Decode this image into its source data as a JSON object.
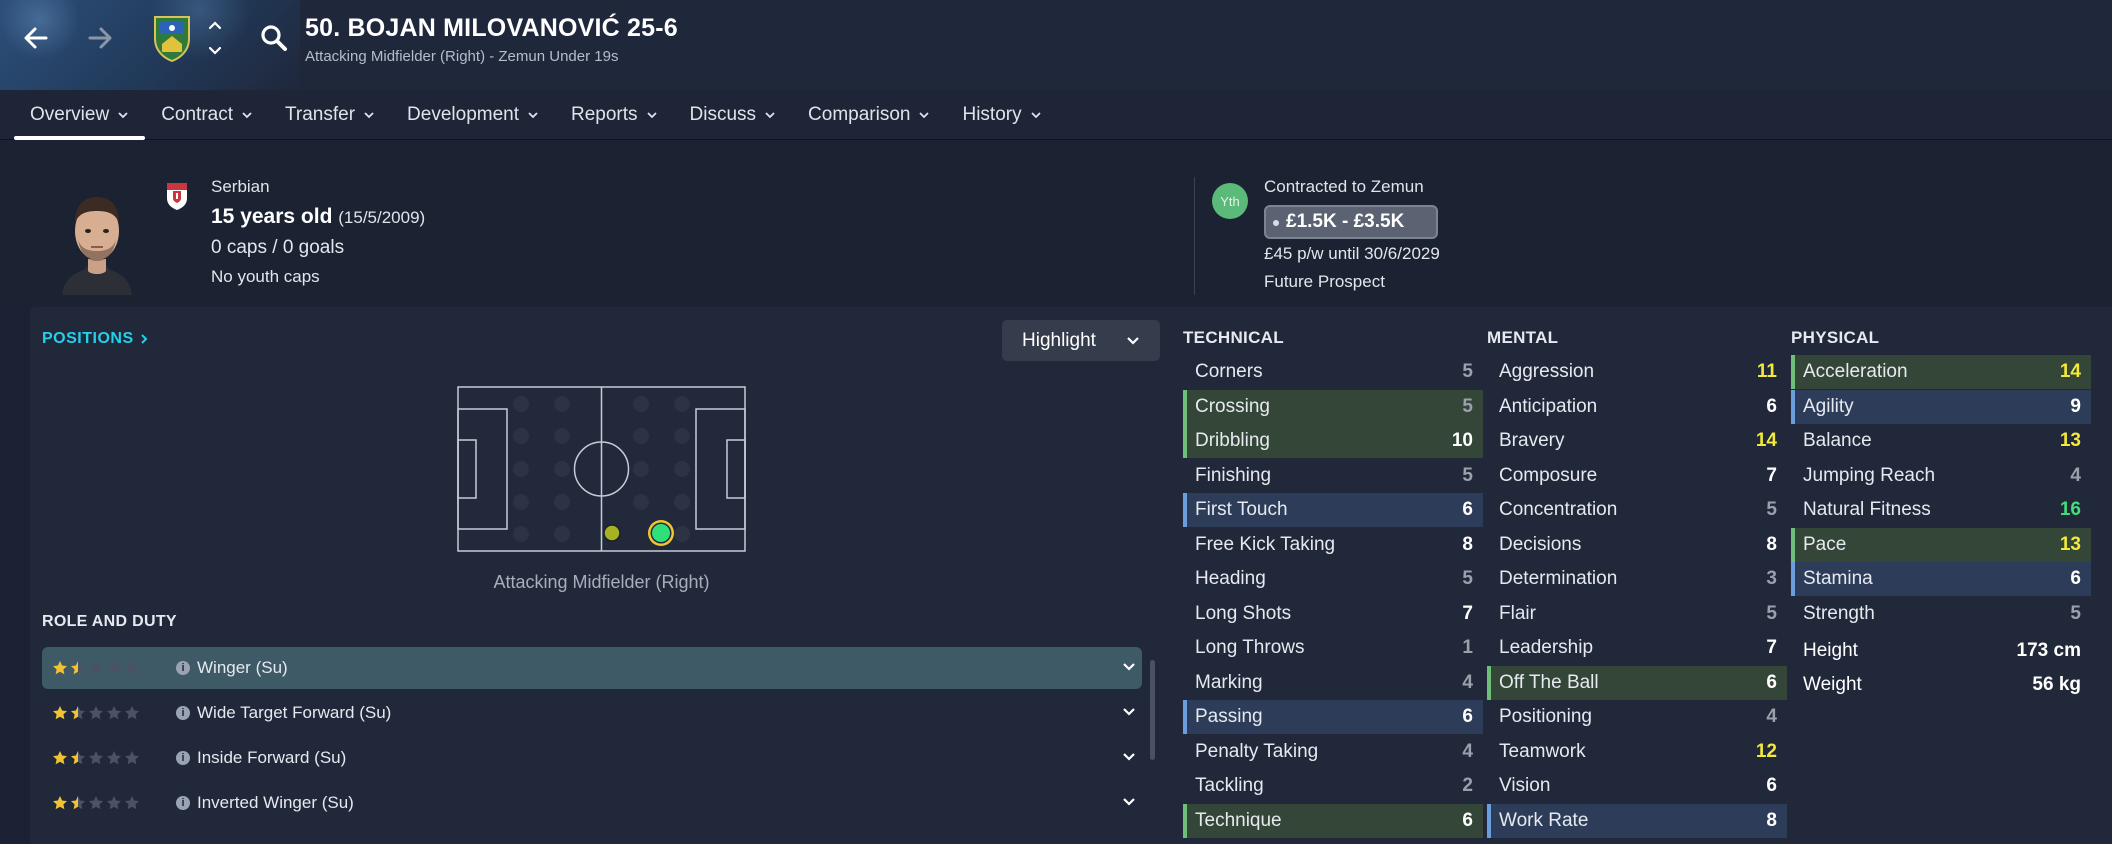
{
  "header": {
    "title": "50. BOJAN MILOVANOVIĆ 25-6",
    "subtitle": "Attacking Midfielder (Right) - Zemun Under 19s"
  },
  "tabs": [
    {
      "label": "Overview"
    },
    {
      "label": "Contract"
    },
    {
      "label": "Transfer"
    },
    {
      "label": "Development"
    },
    {
      "label": "Reports"
    },
    {
      "label": "Discuss"
    },
    {
      "label": "Comparison"
    },
    {
      "label": "History"
    }
  ],
  "profile": {
    "nationality": "Serbian",
    "age": "15 years old",
    "dob": "(15/5/2009)",
    "caps": "0 caps / 0 goals",
    "youth_caps": "No youth caps",
    "badge": "Yth",
    "contract": "Contracted to Zemun",
    "value": "£1.5K - £3.5K",
    "wage": "£45 p/w until 30/6/2029",
    "prospect": "Future Prospect"
  },
  "positions": {
    "link": "POSITIONS",
    "highlight": "Highlight",
    "caption": "Attacking Midfielder (Right)"
  },
  "role_duty": {
    "title": "ROLE AND DUTY",
    "roles": [
      {
        "label": "Winger (Su)",
        "stars": 1.5
      },
      {
        "label": "Wide Target Forward (Su)",
        "stars": 1.5
      },
      {
        "label": "Inside Forward (Su)",
        "stars": 1.5
      },
      {
        "label": "Inverted Winger (Su)",
        "stars": 1.5
      }
    ]
  },
  "attributes": {
    "technical_title": "TECHNICAL",
    "mental_title": "MENTAL",
    "physical_title": "PHYSICAL",
    "technical": [
      {
        "name": "Corners",
        "value": "5",
        "hl": "plain"
      },
      {
        "name": "Crossing",
        "value": "5",
        "hl": "green"
      },
      {
        "name": "Dribbling",
        "value": "10",
        "hl": "green"
      },
      {
        "name": "Finishing",
        "value": "5",
        "hl": "plain"
      },
      {
        "name": "First Touch",
        "value": "6",
        "hl": "blue"
      },
      {
        "name": "Free Kick Taking",
        "value": "8",
        "hl": "plain"
      },
      {
        "name": "Heading",
        "value": "5",
        "hl": "plain"
      },
      {
        "name": "Long Shots",
        "value": "7",
        "hl": "plain"
      },
      {
        "name": "Long Throws",
        "value": "1",
        "hl": "plain"
      },
      {
        "name": "Marking",
        "value": "4",
        "hl": "plain"
      },
      {
        "name": "Passing",
        "value": "6",
        "hl": "blue"
      },
      {
        "name": "Penalty Taking",
        "value": "4",
        "hl": "plain"
      },
      {
        "name": "Tackling",
        "value": "2",
        "hl": "plain"
      },
      {
        "name": "Technique",
        "value": "6",
        "hl": "green"
      }
    ],
    "mental": [
      {
        "name": "Aggression",
        "value": "11",
        "hl": "plain"
      },
      {
        "name": "Anticipation",
        "value": "6",
        "hl": "plain"
      },
      {
        "name": "Bravery",
        "value": "14",
        "hl": "plain"
      },
      {
        "name": "Composure",
        "value": "7",
        "hl": "plain"
      },
      {
        "name": "Concentration",
        "value": "5",
        "hl": "plain"
      },
      {
        "name": "Decisions",
        "value": "8",
        "hl": "plain"
      },
      {
        "name": "Determination",
        "value": "3",
        "hl": "plain"
      },
      {
        "name": "Flair",
        "value": "5",
        "hl": "plain"
      },
      {
        "name": "Leadership",
        "value": "7",
        "hl": "plain"
      },
      {
        "name": "Off The Ball",
        "value": "6",
        "hl": "green"
      },
      {
        "name": "Positioning",
        "value": "4",
        "hl": "plain"
      },
      {
        "name": "Teamwork",
        "value": "12",
        "hl": "plain"
      },
      {
        "name": "Vision",
        "value": "6",
        "hl": "plain"
      },
      {
        "name": "Work Rate",
        "value": "8",
        "hl": "blue"
      }
    ],
    "physical": [
      {
        "name": "Acceleration",
        "value": "14",
        "hl": "green"
      },
      {
        "name": "Agility",
        "value": "9",
        "hl": "blue"
      },
      {
        "name": "Balance",
        "value": "13",
        "hl": "plain"
      },
      {
        "name": "Jumping Reach",
        "value": "4",
        "hl": "plain"
      },
      {
        "name": "Natural Fitness",
        "value": "16",
        "hl": "plain"
      },
      {
        "name": "Pace",
        "value": "13",
        "hl": "green"
      },
      {
        "name": "Stamina",
        "value": "6",
        "hl": "blue"
      },
      {
        "name": "Strength",
        "value": "5",
        "hl": "plain"
      }
    ],
    "height_label": "Height",
    "height": "173 cm",
    "weight_label": "Weight",
    "weight": "56 kg"
  },
  "colors": {
    "low": "#9aa1ad",
    "mid": "#ffffff",
    "good": "#f2e93a",
    "great": "#3fe07a"
  },
  "icons": [
    "back-arrow-icon",
    "forward-arrow-icon",
    "club-crest-icon",
    "chevron-up-icon",
    "chevron-down-icon",
    "search-icon",
    "serbia-flag-icon",
    "info-icon",
    "star-icon"
  ]
}
